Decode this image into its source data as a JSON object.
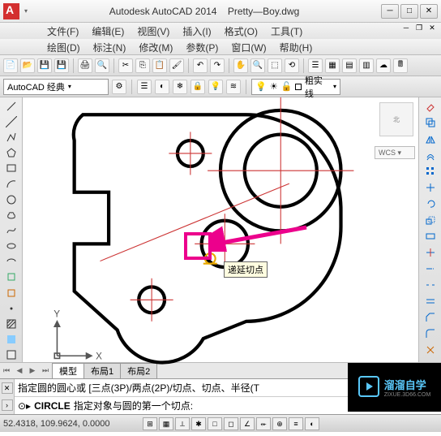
{
  "title": {
    "app": "Autodesk AutoCAD 2014",
    "doc": "Pretty—Boy.dwg"
  },
  "menus1": [
    "文件(F)",
    "编辑(E)",
    "视图(V)",
    "插入(I)",
    "格式(O)",
    "工具(T)"
  ],
  "menus2": [
    "绘图(D)",
    "标注(N)",
    "修改(M)",
    "参数(P)",
    "窗口(W)",
    "帮助(H)"
  ],
  "workspace": "AutoCAD 经典",
  "linetype": "粗实线",
  "wcs": "WCS",
  "nav_top": "北",
  "tabs": {
    "model": "模型",
    "layout1": "布局1",
    "layout2": "布局2"
  },
  "cmd1": "指定圆的圆心或 [三点(3P)/两点(2P)/切点、切点、半径(T",
  "cmd2_prefix": "CIRCLE",
  "cmd2_text": "指定对象与圆的第一个切点:",
  "coords": "52.4318, 109.9624, 0.0000",
  "tooltip": "递延切点",
  "axes": {
    "x": "X",
    "y": "Y"
  },
  "watermark": {
    "brand": "溜溜自学",
    "url": "ZIXUE.3D66.COM"
  }
}
